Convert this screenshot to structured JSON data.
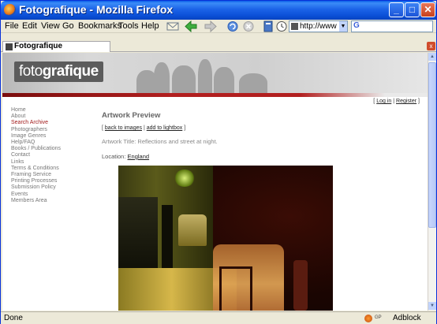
{
  "window": {
    "title": "Fotografique - Mozilla Firefox",
    "min": "_",
    "max": "□",
    "close": "✕"
  },
  "menu": [
    "File",
    "Edit",
    "View",
    "Go",
    "Bookmarks",
    "Tools",
    "Help"
  ],
  "toolbar": {
    "icons": [
      "mail-icon",
      "back-arrow-icon",
      "forward-arrow-icon",
      "reload-icon",
      "stop-icon",
      "bookmark-book-icon",
      "history-clock-icon"
    ],
    "url_value": "http://www",
    "url_dropdown": "▼",
    "search_engine_label": "G"
  },
  "tab": {
    "label": "Fotografique",
    "close": "x"
  },
  "site": {
    "logo_light": "foto",
    "logo_bold": "grafique",
    "top_links": {
      "open": "[",
      "login": "Log in",
      "sep": "|",
      "register": "Register",
      "close": "]"
    },
    "nav": [
      {
        "label": "Home",
        "active": false
      },
      {
        "label": "About",
        "active": false
      },
      {
        "label": "Search Archive",
        "active": true
      },
      {
        "label": "Photographers",
        "active": false
      },
      {
        "label": "Image Genres",
        "active": false
      },
      {
        "label": "Help/FAQ",
        "active": false
      },
      {
        "label": "Books / Publications",
        "active": false
      },
      {
        "label": "Contact",
        "active": false
      },
      {
        "label": "Links",
        "active": false
      },
      {
        "label": "Terms & Conditions",
        "active": false
      },
      {
        "label": "Framing Service",
        "active": false
      },
      {
        "label": "Printing Processes",
        "active": false
      },
      {
        "label": "Submission Policy",
        "active": false
      },
      {
        "label": "Events",
        "active": false
      },
      {
        "label": "Members Area",
        "active": false
      }
    ],
    "main": {
      "heading": "Artwork Preview",
      "actions": {
        "open": "[",
        "back": "back to images",
        "sep": "|",
        "lightbox": "add to lightbox",
        "close": "]"
      },
      "artwork_title": "Artwork Title: Reflections and street at night.",
      "location_label": "Location:",
      "location_value": "England"
    }
  },
  "statusbar": {
    "status": "Done",
    "gp_label": "GP",
    "adblock": "Adblock"
  },
  "colors": {
    "titlebar": "#0a4fd6",
    "accent_red": "#b21f1f",
    "active_nav": "#a21b1b",
    "chrome": "#ece9d8"
  }
}
